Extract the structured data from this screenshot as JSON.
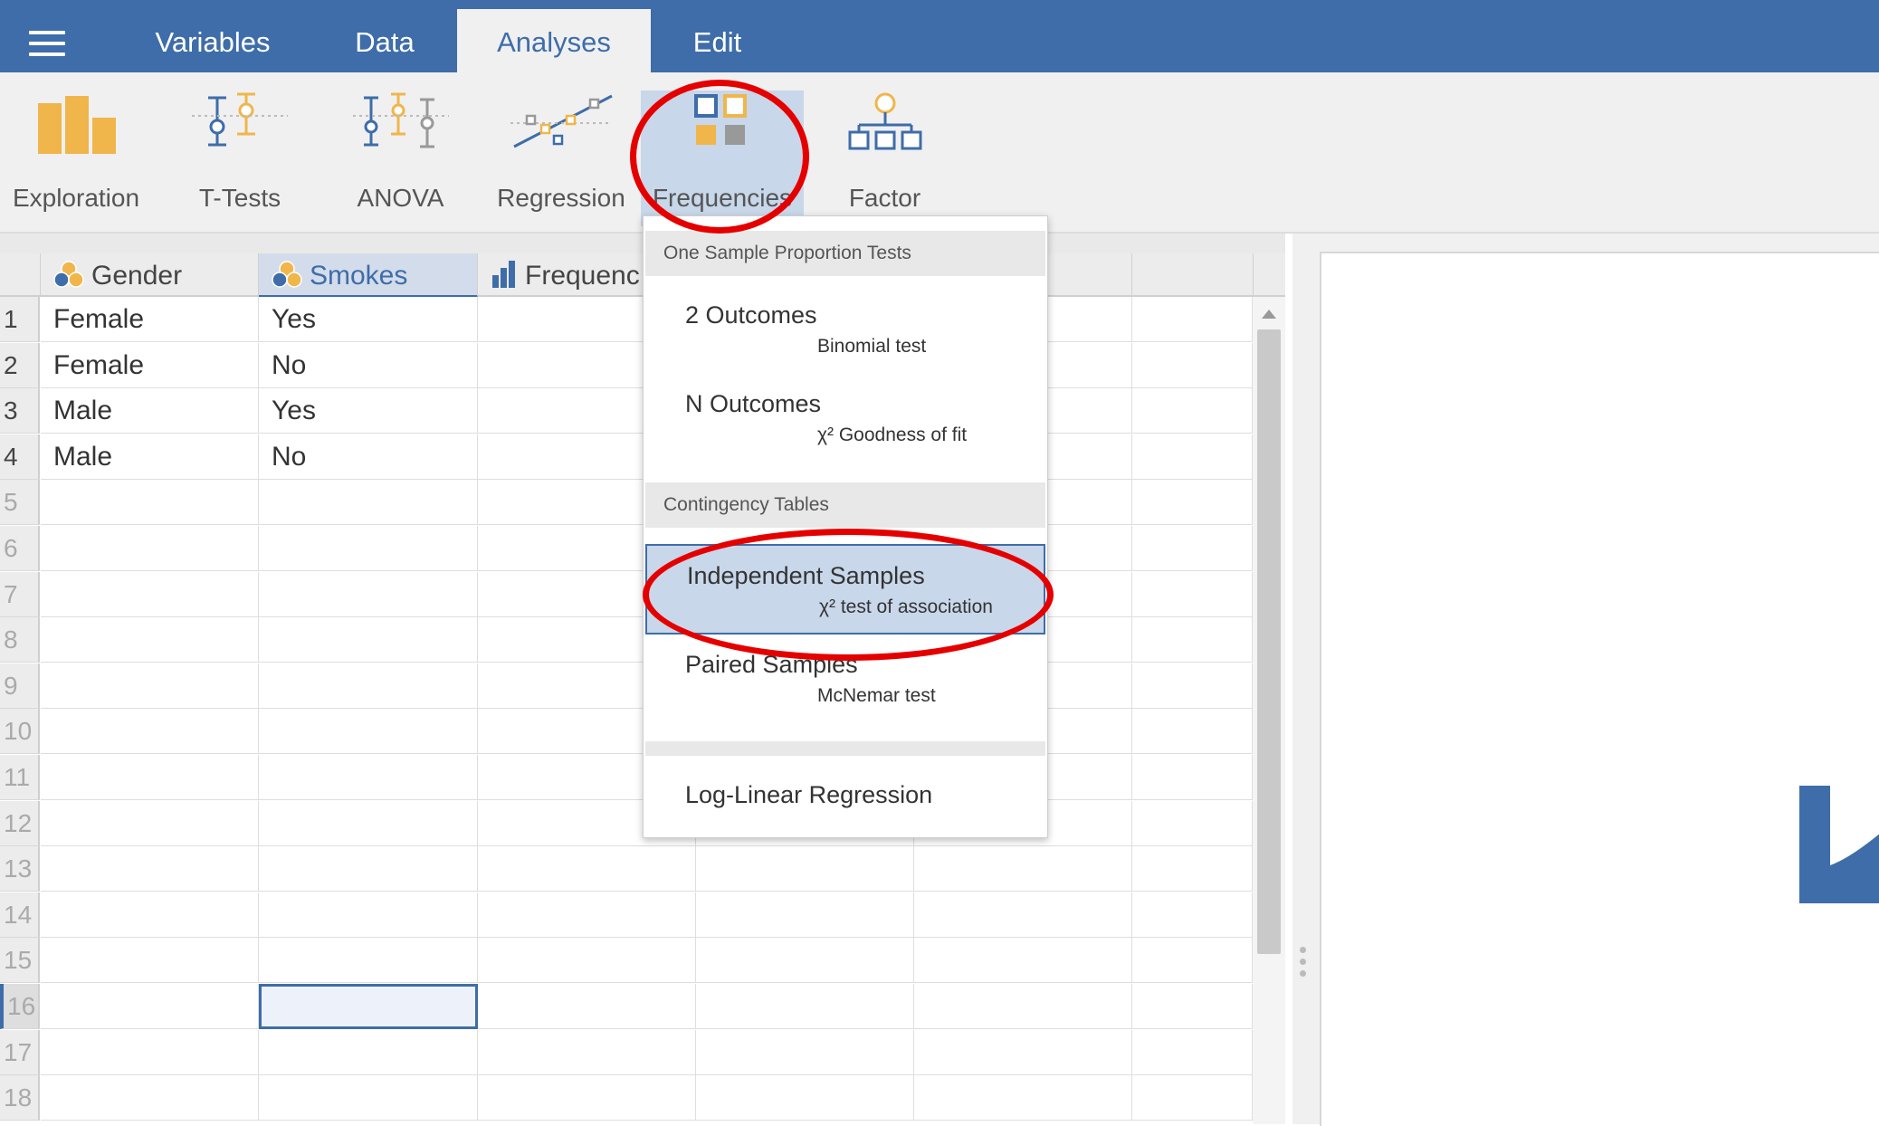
{
  "menu": {
    "tabs": [
      {
        "label": "Variables"
      },
      {
        "label": "Data"
      },
      {
        "label": "Analyses"
      },
      {
        "label": "Edit"
      }
    ]
  },
  "ribbon": {
    "tools": [
      {
        "label": "Exploration",
        "icon": "bar-chart-icon"
      },
      {
        "label": "T-Tests",
        "icon": "ttest-icon"
      },
      {
        "label": "ANOVA",
        "icon": "anova-icon"
      },
      {
        "label": "Regression",
        "icon": "regression-icon"
      },
      {
        "label": "Frequencies",
        "icon": "frequencies-icon"
      },
      {
        "label": "Factor",
        "icon": "factor-icon"
      }
    ]
  },
  "spreadsheet": {
    "columns": [
      {
        "label": "Gender",
        "icon": "nominal-variable-icon"
      },
      {
        "label": "Smokes",
        "icon": "nominal-variable-icon"
      },
      {
        "label": "Frequenc",
        "icon": "continuous-variable-icon"
      }
    ],
    "row_numbers": [
      "1",
      "2",
      "3",
      "4",
      "5",
      "6",
      "7",
      "8",
      "9",
      "10",
      "11",
      "12",
      "13",
      "14",
      "15",
      "16",
      "17",
      "18"
    ],
    "rows": [
      [
        "Female",
        "Yes"
      ],
      [
        "Female",
        "No"
      ],
      [
        "Male",
        "Yes"
      ],
      [
        "Male",
        "No"
      ]
    ],
    "selected_row": "16"
  },
  "dropdown": {
    "section_1": "One Sample Proportion Tests",
    "item_2_outcomes": {
      "title": "2 Outcomes",
      "subtitle": "Binomial test"
    },
    "item_n_outcomes": {
      "title": "N Outcomes",
      "subtitle": "χ² Goodness of fit"
    },
    "section_2": "Contingency Tables",
    "item_independent": {
      "title": "Independent Samples",
      "subtitle": "χ² test of association"
    },
    "item_paired": {
      "title": "Paired Samples",
      "subtitle": "McNemar test"
    },
    "item_loglinear": {
      "title": "Log-Linear Regression"
    }
  },
  "colors": {
    "brand": "#3e6da9",
    "annotation": "#e50000",
    "icon_orange": "#f0b64b"
  }
}
